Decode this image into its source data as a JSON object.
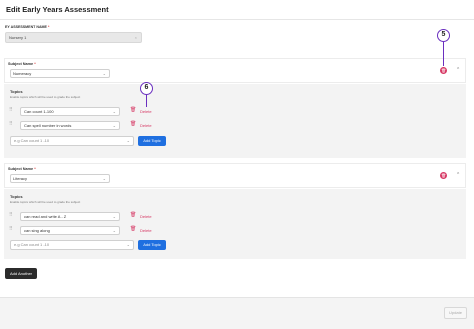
{
  "title": "Edit Early Years Assessment",
  "assessment": {
    "label": "EY ASSESSMENT NAME",
    "required": "*",
    "value": "Nursery 1",
    "clear": "×"
  },
  "subjects": [
    {
      "label": "Subject Name",
      "required": "*",
      "value": "Numeracy",
      "topics_label": "Topics",
      "topics_help": "Enable topics which will be used to grade the subject",
      "topics": [
        {
          "value": "Can count 1-100",
          "delete_label": "Delete"
        },
        {
          "value": "Can spell number in words",
          "delete_label": "Delete"
        }
      ],
      "new_topic_placeholder": "e.g Can count 1 -10",
      "add_topic_label": "Add Topic"
    },
    {
      "label": "Subject Name",
      "required": "*",
      "value": "Literacy",
      "topics_label": "Topics",
      "topics_help": "Enable topics which will be used to grade the subject",
      "topics": [
        {
          "value": "can read and write A - Z",
          "delete_label": "Delete"
        },
        {
          "value": "can sing along",
          "delete_label": "Delete"
        }
      ],
      "new_topic_placeholder": "e.g Can count 1 -10",
      "add_topic_label": "Add Topic"
    }
  ],
  "add_another_label": "Add Another",
  "update_label": "Update",
  "callouts": [
    "5",
    "6"
  ],
  "colors": {
    "accent": "#1f6fe0",
    "danger": "#d63864",
    "callout": "#6a2fbf",
    "dark_button": "#2b2b2b"
  },
  "icons": {
    "drag": "drag-handle-icon",
    "trash": "trash-icon",
    "chevron": "chevron-icon"
  }
}
